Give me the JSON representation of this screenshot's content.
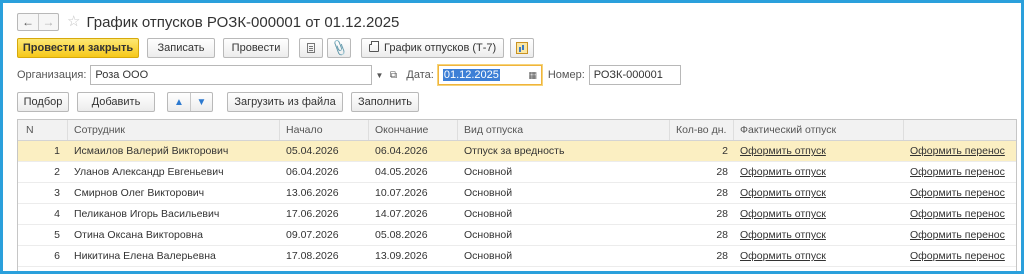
{
  "title": {
    "text": "График отпусков РОЗК-000001 от 01.12.2025"
  },
  "commands": {
    "post_and_close": "Провести и закрыть",
    "write": "Записать",
    "post": "Провести",
    "print_schedule": "График отпусков (Т-7)"
  },
  "fields": {
    "org_label": "Организация:",
    "org_value": "Роза ООО",
    "date_label": "Дата:",
    "date_value": "01.12.2025",
    "number_label": "Номер:",
    "number_value": "РОЗК-000001"
  },
  "table_toolbar": {
    "select": "Подбор",
    "add": "Добавить",
    "load_from_file": "Загрузить из файла",
    "fill": "Заполнить"
  },
  "table": {
    "columns": {
      "n": "N",
      "employee": "Сотрудник",
      "start": "Начало",
      "end": "Окончание",
      "type": "Вид отпуска",
      "days": "Кол-во дн.",
      "actual": "Фактический отпуск"
    },
    "link_actual": "Оформить отпуск",
    "link_transfer": "Оформить перенос",
    "rows": [
      {
        "n": "1",
        "employee": "Исмаилов Валерий Викторович",
        "start": "05.04.2026",
        "end": "06.04.2026",
        "type": "Отпуск за вредность",
        "days": "2",
        "actual": "Оформить отпуск",
        "transfer": "Оформить перенос"
      },
      {
        "n": "2",
        "employee": "Уланов Александр Евгеньевич",
        "start": "06.04.2026",
        "end": "04.05.2026",
        "type": "Основной",
        "days": "28",
        "actual": "Оформить отпуск",
        "transfer": "Оформить перенос"
      },
      {
        "n": "3",
        "employee": "Смирнов Олег Викторович",
        "start": "13.06.2026",
        "end": "10.07.2026",
        "type": "Основной",
        "days": "28",
        "actual": "Оформить отпуск",
        "transfer": "Оформить перенос"
      },
      {
        "n": "4",
        "employee": "Пеликанов Игорь Васильевич",
        "start": "17.06.2026",
        "end": "14.07.2026",
        "type": "Основной",
        "days": "28",
        "actual": "Оформить отпуск",
        "transfer": "Оформить перенос"
      },
      {
        "n": "5",
        "employee": "Отина Оксана Викторовна",
        "start": "09.07.2026",
        "end": "05.08.2026",
        "type": "Основной",
        "days": "28",
        "actual": "Оформить отпуск",
        "transfer": "Оформить перенос"
      },
      {
        "n": "6",
        "employee": "Никитина Елена Валерьевна",
        "start": "17.08.2026",
        "end": "13.09.2026",
        "type": "Основной",
        "days": "28",
        "actual": "Оформить отпуск",
        "transfer": "Оформить перенос"
      }
    ]
  },
  "colors": {
    "frame": "#2aa0dc",
    "primary_button": "#f6c819",
    "selected_row": "#fbefc2",
    "date_selection": "#3d7fd6"
  },
  "icons": {
    "back": "arrow-left-icon",
    "forward": "arrow-right-icon",
    "favorite": "star-icon",
    "structure": "document-icon",
    "attach": "paperclip-icon",
    "print": "printer-icon",
    "report": "report-icon",
    "move_up": "arrow-up-icon",
    "move_down": "arrow-down-icon"
  }
}
